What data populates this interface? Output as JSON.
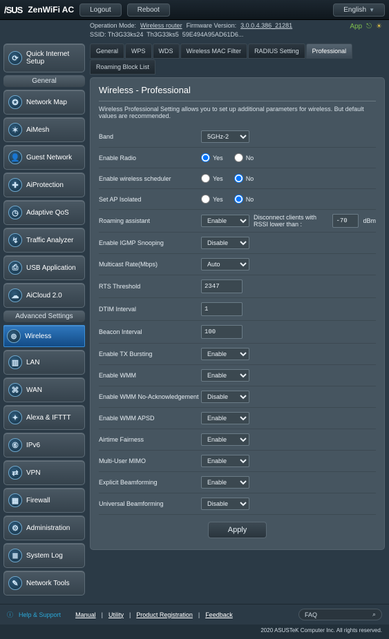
{
  "header": {
    "brand": "/SUS",
    "product": "ZenWiFi AC",
    "logout": "Logout",
    "reboot": "Reboot",
    "language": "English"
  },
  "meta": {
    "opmode_lbl": "Operation Mode:",
    "opmode_val": "Wireless router",
    "fw_lbl": "Firmware Version:",
    "fw_val": "3.0.0.4.386_21281",
    "ssid_lbl": "SSID:",
    "ssid1": "Th3G33ks24",
    "ssid2": "Th3G33ks5",
    "ssid3": "59E494A95AD61D6...",
    "app": "App"
  },
  "sidebar": {
    "qis": "Quick Internet Setup",
    "sect_general": "General",
    "general": [
      "Network Map",
      "AiMesh",
      "Guest Network",
      "AiProtection",
      "Adaptive QoS",
      "Traffic Analyzer",
      "USB Application",
      "AiCloud 2.0"
    ],
    "sect_adv": "Advanced Settings",
    "adv": [
      "Wireless",
      "LAN",
      "WAN",
      "Alexa & IFTTT",
      "IPv6",
      "VPN",
      "Firewall",
      "Administration",
      "System Log",
      "Network Tools"
    ]
  },
  "tabs": [
    "General",
    "WPS",
    "WDS",
    "Wireless MAC Filter",
    "RADIUS Setting",
    "Professional",
    "Roaming Block List"
  ],
  "panel": {
    "title": "Wireless - Professional",
    "desc": "Wireless Professional Setting allows you to set up additional parameters for wireless. But default values are recommended.",
    "yes": "Yes",
    "no": "No",
    "rows": {
      "band_lbl": "Band",
      "band_val": "5GHz-2",
      "er_lbl": "Enable Radio",
      "ews_lbl": "Enable wireless scheduler",
      "api_lbl": "Set AP Isolated",
      "ra_lbl": "Roaming assistant",
      "ra_val": "Enable",
      "ra_txt": "Disconnect clients with RSSI lower than :",
      "ra_num": "-70",
      "ra_unit": "dBm",
      "igmp_lbl": "Enable IGMP Snooping",
      "igmp_val": "Disable",
      "mcr_lbl": "Multicast Rate(Mbps)",
      "mcr_val": "Auto",
      "rts_lbl": "RTS Threshold",
      "rts_val": "2347",
      "dtim_lbl": "DTIM Interval",
      "dtim_val": "1",
      "bi_lbl": "Beacon Interval",
      "bi_val": "100",
      "txb_lbl": "Enable TX Bursting",
      "txb_val": "Enable",
      "wmm_lbl": "Enable WMM",
      "wmm_val": "Enable",
      "wmmna_lbl": "Enable WMM No-Acknowledgement",
      "wmmna_val": "Disable",
      "wmmap_lbl": "Enable WMM APSD",
      "wmmap_val": "Enable",
      "af_lbl": "Airtime Fairness",
      "af_val": "Enable",
      "mu_lbl": "Multi-User MIMO",
      "mu_val": "Enable",
      "ebf_lbl": "Explicit Beamforming",
      "ebf_val": "Enable",
      "ubf_lbl": "Universal Beamforming",
      "ubf_val": "Disable"
    },
    "apply": "Apply"
  },
  "footer": {
    "help": "Help & Support",
    "links": [
      "Manual",
      "Utility",
      "Product Registration",
      "Feedback"
    ],
    "faq": "FAQ",
    "copyright": "2020 ASUSTeK Computer Inc. All rights reserved."
  }
}
